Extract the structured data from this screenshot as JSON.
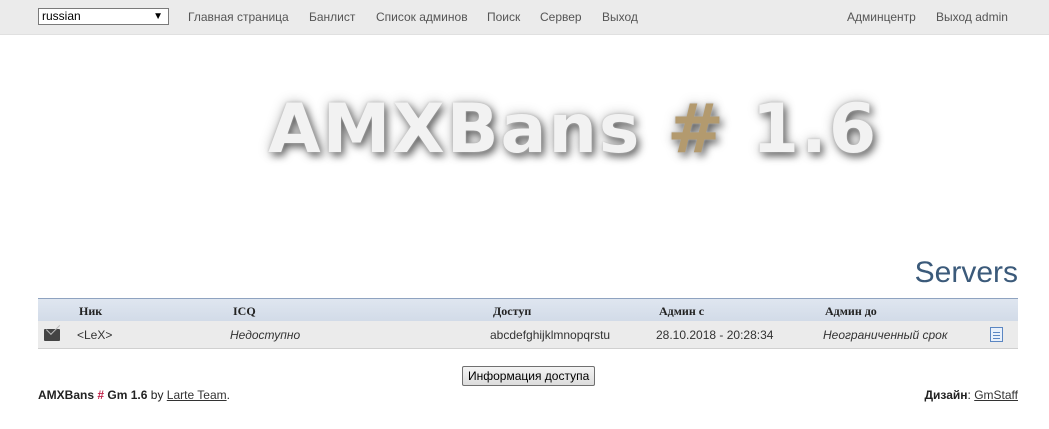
{
  "nav": {
    "language": "russian",
    "links": [
      "Главная страница",
      "Банлист",
      "Список админов",
      "Поиск",
      "Сервер",
      "Выход"
    ],
    "right_links": [
      "Админцентр",
      "Выход admin"
    ]
  },
  "logo": {
    "main": "AMXBans",
    "hash": "#",
    "version": "1.6"
  },
  "section_title": "Servers",
  "table": {
    "headers": [
      "Ник",
      "ICQ",
      "Доступ",
      "Админ с",
      "Админ до"
    ],
    "rows": [
      {
        "nick": "<LeX>",
        "icq": "Недоступно",
        "access": "abcdefghijklmnopqrstu",
        "admin_from": "28.10.2018 - 20:28:34",
        "admin_to": "Неограниченный срок"
      }
    ]
  },
  "access_info_button": "Информация доступа",
  "footer": {
    "left_brand": "AMXBans",
    "left_hash": "#",
    "left_version": "Gm 1.6",
    "by": "by",
    "team": "Larte Team",
    "dot": ".",
    "design_label": "Дизайн",
    "design_sep": ":",
    "design_link": "GmStaff"
  },
  "colors": {
    "accent_title": "#3b5a7a",
    "hash_gold": "#b39a6e",
    "footer_hash": "#c0244a"
  }
}
